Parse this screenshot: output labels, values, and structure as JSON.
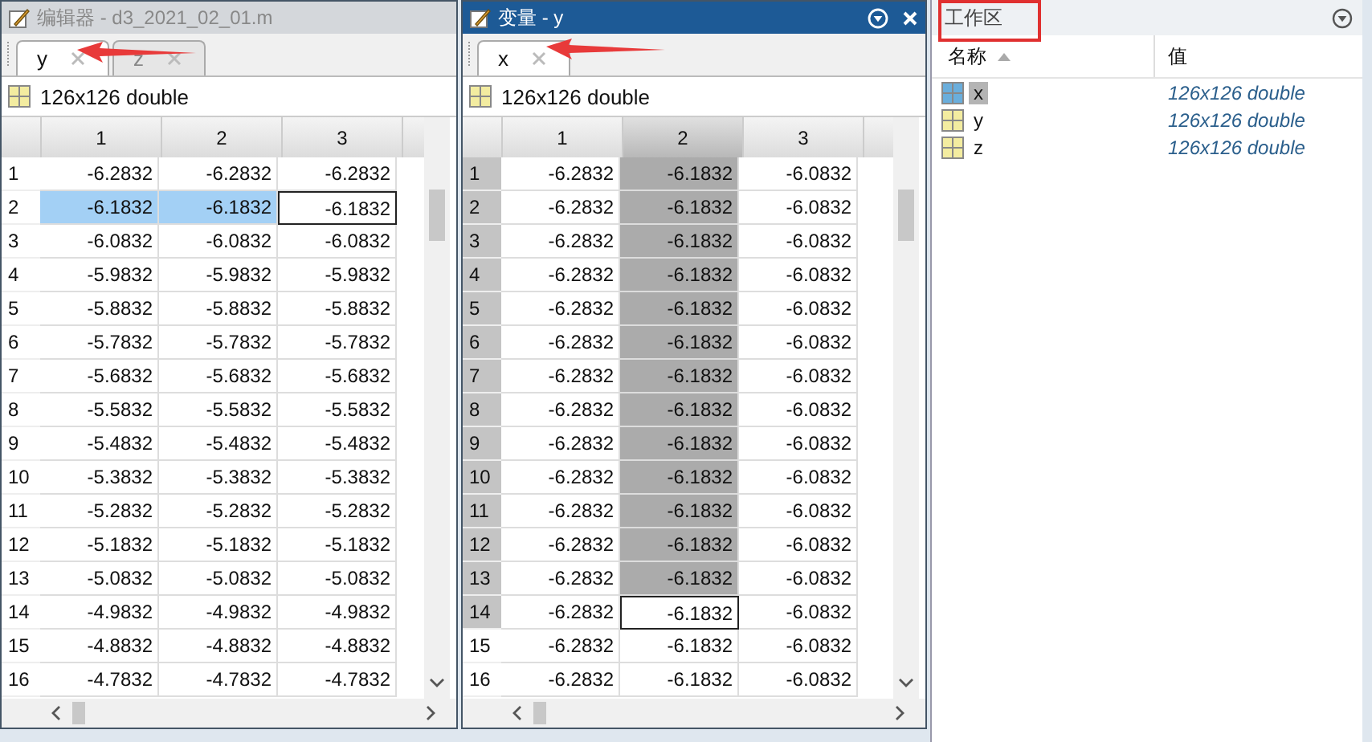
{
  "panels": [
    {
      "title": "编辑器 - d3_2021_02_01.m",
      "active": false,
      "tabs": [
        {
          "label": "y",
          "selected": true
        },
        {
          "label": "z",
          "selected": false
        }
      ],
      "info": "126x126 double",
      "columns": [
        {
          "label": "1",
          "selected": false
        },
        {
          "label": "2",
          "selected": false
        },
        {
          "label": "3",
          "selected": false
        }
      ],
      "rows": [
        {
          "header": "1",
          "selected": false,
          "cells": [
            {
              "text": "-6.2832",
              "selected": false,
              "current": false
            },
            {
              "text": "-6.2832",
              "selected": false,
              "current": false
            },
            {
              "text": "-6.2832",
              "selected": false,
              "current": false
            }
          ]
        },
        {
          "header": "2",
          "selected": false,
          "cells": [
            {
              "text": "-6.1832",
              "selected": true,
              "current": false
            },
            {
              "text": "-6.1832",
              "selected": true,
              "current": false
            },
            {
              "text": "-6.1832",
              "selected": false,
              "current": true
            }
          ]
        },
        {
          "header": "3",
          "selected": false,
          "cells": [
            {
              "text": "-6.0832",
              "selected": false,
              "current": false
            },
            {
              "text": "-6.0832",
              "selected": false,
              "current": false
            },
            {
              "text": "-6.0832",
              "selected": false,
              "current": false
            }
          ]
        },
        {
          "header": "4",
          "selected": false,
          "cells": [
            {
              "text": "-5.9832",
              "selected": false,
              "current": false
            },
            {
              "text": "-5.9832",
              "selected": false,
              "current": false
            },
            {
              "text": "-5.9832",
              "selected": false,
              "current": false
            }
          ]
        },
        {
          "header": "5",
          "selected": false,
          "cells": [
            {
              "text": "-5.8832",
              "selected": false,
              "current": false
            },
            {
              "text": "-5.8832",
              "selected": false,
              "current": false
            },
            {
              "text": "-5.8832",
              "selected": false,
              "current": false
            }
          ]
        },
        {
          "header": "6",
          "selected": false,
          "cells": [
            {
              "text": "-5.7832",
              "selected": false,
              "current": false
            },
            {
              "text": "-5.7832",
              "selected": false,
              "current": false
            },
            {
              "text": "-5.7832",
              "selected": false,
              "current": false
            }
          ]
        },
        {
          "header": "7",
          "selected": false,
          "cells": [
            {
              "text": "-5.6832",
              "selected": false,
              "current": false
            },
            {
              "text": "-5.6832",
              "selected": false,
              "current": false
            },
            {
              "text": "-5.6832",
              "selected": false,
              "current": false
            }
          ]
        },
        {
          "header": "8",
          "selected": false,
          "cells": [
            {
              "text": "-5.5832",
              "selected": false,
              "current": false
            },
            {
              "text": "-5.5832",
              "selected": false,
              "current": false
            },
            {
              "text": "-5.5832",
              "selected": false,
              "current": false
            }
          ]
        },
        {
          "header": "9",
          "selected": false,
          "cells": [
            {
              "text": "-5.4832",
              "selected": false,
              "current": false
            },
            {
              "text": "-5.4832",
              "selected": false,
              "current": false
            },
            {
              "text": "-5.4832",
              "selected": false,
              "current": false
            }
          ]
        },
        {
          "header": "10",
          "selected": false,
          "cells": [
            {
              "text": "-5.3832",
              "selected": false,
              "current": false
            },
            {
              "text": "-5.3832",
              "selected": false,
              "current": false
            },
            {
              "text": "-5.3832",
              "selected": false,
              "current": false
            }
          ]
        },
        {
          "header": "11",
          "selected": false,
          "cells": [
            {
              "text": "-5.2832",
              "selected": false,
              "current": false
            },
            {
              "text": "-5.2832",
              "selected": false,
              "current": false
            },
            {
              "text": "-5.2832",
              "selected": false,
              "current": false
            }
          ]
        },
        {
          "header": "12",
          "selected": false,
          "cells": [
            {
              "text": "-5.1832",
              "selected": false,
              "current": false
            },
            {
              "text": "-5.1832",
              "selected": false,
              "current": false
            },
            {
              "text": "-5.1832",
              "selected": false,
              "current": false
            }
          ]
        },
        {
          "header": "13",
          "selected": false,
          "cells": [
            {
              "text": "-5.0832",
              "selected": false,
              "current": false
            },
            {
              "text": "-5.0832",
              "selected": false,
              "current": false
            },
            {
              "text": "-5.0832",
              "selected": false,
              "current": false
            }
          ]
        },
        {
          "header": "14",
          "selected": false,
          "cells": [
            {
              "text": "-4.9832",
              "selected": false,
              "current": false
            },
            {
              "text": "-4.9832",
              "selected": false,
              "current": false
            },
            {
              "text": "-4.9832",
              "selected": false,
              "current": false
            }
          ]
        },
        {
          "header": "15",
          "selected": false,
          "cells": [
            {
              "text": "-4.8832",
              "selected": false,
              "current": false
            },
            {
              "text": "-4.8832",
              "selected": false,
              "current": false
            },
            {
              "text": "-4.8832",
              "selected": false,
              "current": false
            }
          ]
        },
        {
          "header": "16",
          "selected": false,
          "cells": [
            {
              "text": "-4.7832",
              "selected": false,
              "current": false
            },
            {
              "text": "-4.7832",
              "selected": false,
              "current": false
            },
            {
              "text": "-4.7832",
              "selected": false,
              "current": false
            }
          ]
        }
      ]
    },
    {
      "title": "变量 - y",
      "active": true,
      "menu_button": true,
      "close_button": true,
      "tabs": [
        {
          "label": "x",
          "selected": true
        }
      ],
      "info": "126x126 double",
      "columns": [
        {
          "label": "1",
          "selected": false
        },
        {
          "label": "2",
          "selected": true
        },
        {
          "label": "3",
          "selected": false
        }
      ],
      "rows": [
        {
          "header": "1",
          "selected": true,
          "cells": [
            {
              "text": "-6.2832",
              "selected": false,
              "current": false
            },
            {
              "text": "-6.1832",
              "selected": true,
              "current": false
            },
            {
              "text": "-6.0832",
              "selected": false,
              "current": false
            }
          ]
        },
        {
          "header": "2",
          "selected": true,
          "cells": [
            {
              "text": "-6.2832",
              "selected": false,
              "current": false
            },
            {
              "text": "-6.1832",
              "selected": true,
              "current": false
            },
            {
              "text": "-6.0832",
              "selected": false,
              "current": false
            }
          ]
        },
        {
          "header": "3",
          "selected": true,
          "cells": [
            {
              "text": "-6.2832",
              "selected": false,
              "current": false
            },
            {
              "text": "-6.1832",
              "selected": true,
              "current": false
            },
            {
              "text": "-6.0832",
              "selected": false,
              "current": false
            }
          ]
        },
        {
          "header": "4",
          "selected": true,
          "cells": [
            {
              "text": "-6.2832",
              "selected": false,
              "current": false
            },
            {
              "text": "-6.1832",
              "selected": true,
              "current": false
            },
            {
              "text": "-6.0832",
              "selected": false,
              "current": false
            }
          ]
        },
        {
          "header": "5",
          "selected": true,
          "cells": [
            {
              "text": "-6.2832",
              "selected": false,
              "current": false
            },
            {
              "text": "-6.1832",
              "selected": true,
              "current": false
            },
            {
              "text": "-6.0832",
              "selected": false,
              "current": false
            }
          ]
        },
        {
          "header": "6",
          "selected": true,
          "cells": [
            {
              "text": "-6.2832",
              "selected": false,
              "current": false
            },
            {
              "text": "-6.1832",
              "selected": true,
              "current": false
            },
            {
              "text": "-6.0832",
              "selected": false,
              "current": false
            }
          ]
        },
        {
          "header": "7",
          "selected": true,
          "cells": [
            {
              "text": "-6.2832",
              "selected": false,
              "current": false
            },
            {
              "text": "-6.1832",
              "selected": true,
              "current": false
            },
            {
              "text": "-6.0832",
              "selected": false,
              "current": false
            }
          ]
        },
        {
          "header": "8",
          "selected": true,
          "cells": [
            {
              "text": "-6.2832",
              "selected": false,
              "current": false
            },
            {
              "text": "-6.1832",
              "selected": true,
              "current": false
            },
            {
              "text": "-6.0832",
              "selected": false,
              "current": false
            }
          ]
        },
        {
          "header": "9",
          "selected": true,
          "cells": [
            {
              "text": "-6.2832",
              "selected": false,
              "current": false
            },
            {
              "text": "-6.1832",
              "selected": true,
              "current": false
            },
            {
              "text": "-6.0832",
              "selected": false,
              "current": false
            }
          ]
        },
        {
          "header": "10",
          "selected": true,
          "cells": [
            {
              "text": "-6.2832",
              "selected": false,
              "current": false
            },
            {
              "text": "-6.1832",
              "selected": true,
              "current": false
            },
            {
              "text": "-6.0832",
              "selected": false,
              "current": false
            }
          ]
        },
        {
          "header": "11",
          "selected": true,
          "cells": [
            {
              "text": "-6.2832",
              "selected": false,
              "current": false
            },
            {
              "text": "-6.1832",
              "selected": true,
              "current": false
            },
            {
              "text": "-6.0832",
              "selected": false,
              "current": false
            }
          ]
        },
        {
          "header": "12",
          "selected": true,
          "cells": [
            {
              "text": "-6.2832",
              "selected": false,
              "current": false
            },
            {
              "text": "-6.1832",
              "selected": true,
              "current": false
            },
            {
              "text": "-6.0832",
              "selected": false,
              "current": false
            }
          ]
        },
        {
          "header": "13",
          "selected": true,
          "cells": [
            {
              "text": "-6.2832",
              "selected": false,
              "current": false
            },
            {
              "text": "-6.1832",
              "selected": true,
              "current": false
            },
            {
              "text": "-6.0832",
              "selected": false,
              "current": false
            }
          ]
        },
        {
          "header": "14",
          "selected": true,
          "cells": [
            {
              "text": "-6.2832",
              "selected": false,
              "current": false
            },
            {
              "text": "-6.1832",
              "selected": false,
              "current": true
            },
            {
              "text": "-6.0832",
              "selected": false,
              "current": false
            }
          ]
        },
        {
          "header": "15",
          "selected": false,
          "cells": [
            {
              "text": "-6.2832",
              "selected": false,
              "current": false
            },
            {
              "text": "-6.1832",
              "selected": false,
              "current": false
            },
            {
              "text": "-6.0832",
              "selected": false,
              "current": false
            }
          ]
        },
        {
          "header": "16",
          "selected": false,
          "cells": [
            {
              "text": "-6.2832",
              "selected": false,
              "current": false
            },
            {
              "text": "-6.1832",
              "selected": false,
              "current": false
            },
            {
              "text": "-6.0832",
              "selected": false,
              "current": false
            }
          ]
        }
      ]
    }
  ],
  "workspace": {
    "title": "工作区",
    "columns": [
      "名称",
      "值"
    ],
    "items": [
      {
        "name": "x",
        "value": "126x126 double",
        "selected": true
      },
      {
        "name": "y",
        "value": "126x126 double",
        "selected": false
      },
      {
        "name": "z",
        "value": "126x126 double",
        "selected": false
      }
    ]
  }
}
